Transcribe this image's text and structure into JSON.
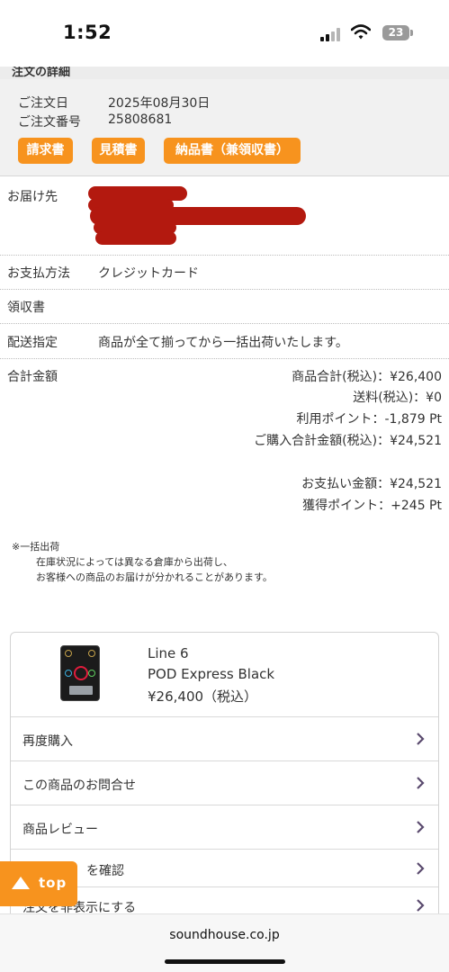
{
  "status_bar": {
    "time": "1:52",
    "battery": "23"
  },
  "section": {
    "title": "注文の詳細"
  },
  "order": {
    "date_label": "ご注文日",
    "date_value": "2025年08月30日",
    "number_label": "ご注文番号",
    "number_value": "25808681",
    "buttons": [
      "請求書",
      "見積書",
      "納品書（兼領収書）"
    ]
  },
  "details": {
    "delivery_label": "お届け先",
    "payment_label": "お支払方法",
    "payment_value": "クレジットカード",
    "receipt_label": "領収書",
    "shipping_label": "配送指定",
    "shipping_value": "商品が全て揃ってから一括出荷いたします。",
    "total_label": "合計金額"
  },
  "totals": {
    "subtotal": "商品合計(税込)：¥26,400",
    "shipping": "送料(税込)：¥0",
    "points_used": "利用ポイント：-1,879 Pt",
    "purchase_total": "ご購入合計金額(税込)：¥24,521",
    "payment_amount": "お支払い金額：¥24,521",
    "points_earned": "獲得ポイント：+245 Pt"
  },
  "note": {
    "title": "※一括出荷",
    "line1": "在庫状況によっては異なる倉庫から出荷し、",
    "line2": "お客様への商品のお届けが分かれることがあります。"
  },
  "product": {
    "brand": "Line 6",
    "name": "POD Express Black",
    "price": "¥26,400（税込）"
  },
  "product_menu": [
    {
      "label": "再度購入"
    },
    {
      "label": "この商品のお問合せ"
    },
    {
      "label": "商品レビュー"
    },
    {
      "label": "を確認"
    },
    {
      "label": "注文を非表示にする"
    }
  ],
  "top_button": {
    "label": "top"
  },
  "browser": {
    "url": "soundhouse.co.jp"
  },
  "colors": {
    "accent": "#f7931e",
    "redaction": "#b3190f",
    "chevron": "#5a4a6e"
  }
}
